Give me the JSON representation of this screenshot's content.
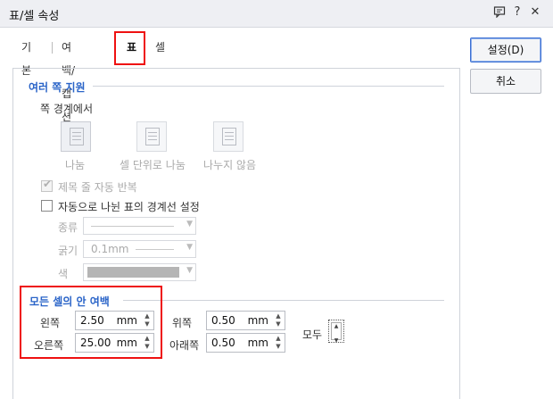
{
  "window": {
    "title": "표/셀 속성"
  },
  "tabs": [
    {
      "label": "기본"
    },
    {
      "label": "여백/캡션"
    },
    {
      "label": "표"
    },
    {
      "label": "셀"
    }
  ],
  "buttons": {
    "ok": "설정(D)",
    "cancel": "취소"
  },
  "multi_page": {
    "group_title": "여러 쪽 지원",
    "boundary_label": "쪽 경계에서",
    "options": [
      {
        "label": "나눔"
      },
      {
        "label": "셀 단위로 나눔"
      },
      {
        "label": "나누지 않음"
      }
    ],
    "repeat_title": {
      "label": "제목 줄 자동 반복",
      "checked": true
    },
    "auto_border": {
      "label": "자동으로 나뉜 표의 경계선 설정",
      "checked": false
    },
    "type_label": "종류",
    "thickness_label": "굵기",
    "thickness_value": "0.1mm",
    "color_label": "색"
  },
  "cell_margin": {
    "group_title": "모든 셀의 안 여백",
    "left": {
      "label": "왼쪽",
      "value": "2.50",
      "unit": "mm"
    },
    "right": {
      "label": "오른쪽",
      "value": "25.00",
      "unit": "mm"
    },
    "top": {
      "label": "위쪽",
      "value": "0.50",
      "unit": "mm"
    },
    "bottom": {
      "label": "아래쪽",
      "value": "0.50",
      "unit": "mm"
    },
    "all_label": "모두"
  }
}
